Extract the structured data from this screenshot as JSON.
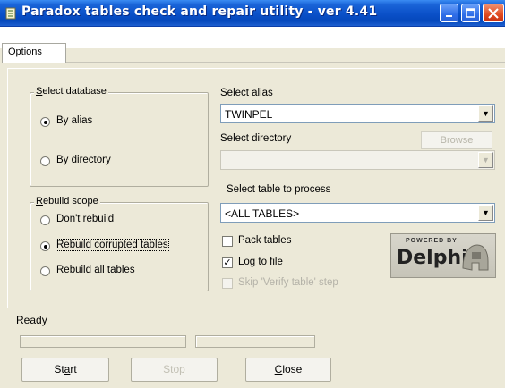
{
  "window": {
    "title": "Paradox tables check and repair utility - ver 4.41"
  },
  "tabs": [
    {
      "label": "Options"
    }
  ],
  "select_database": {
    "title": "Select database",
    "options": [
      {
        "label": "By alias",
        "selected": true
      },
      {
        "label": "By directory",
        "selected": false
      }
    ]
  },
  "rebuild_scope": {
    "title": "Rebuild scope",
    "options": [
      {
        "label": "Don't rebuild",
        "selected": false
      },
      {
        "label": "Rebuild corrupted tables",
        "selected": true
      },
      {
        "label": "Rebuild all tables",
        "selected": false
      }
    ]
  },
  "alias": {
    "label": "Select alias",
    "value": "TWINPEL"
  },
  "directory": {
    "label": "Select directory",
    "value": "",
    "browse_label": "Browse"
  },
  "table": {
    "label": "Select table to process",
    "value": "<ALL TABLES>"
  },
  "options": [
    {
      "label": "Pack tables",
      "checked": false,
      "enabled": true
    },
    {
      "label": "Log to file",
      "checked": true,
      "enabled": true
    },
    {
      "label": "Skip 'Verify table' step",
      "checked": false,
      "enabled": false
    }
  ],
  "logo": {
    "line1": "POWERED BY",
    "line2": "Delphi"
  },
  "status": {
    "text": "Ready",
    "progress": [
      0,
      0
    ]
  },
  "buttons": {
    "start": "Start",
    "stop": "Stop",
    "close": "Close"
  },
  "colors": {
    "titlebar": "#0a50c8",
    "face": "#ece9d8",
    "field_border": "#7f9db9"
  }
}
